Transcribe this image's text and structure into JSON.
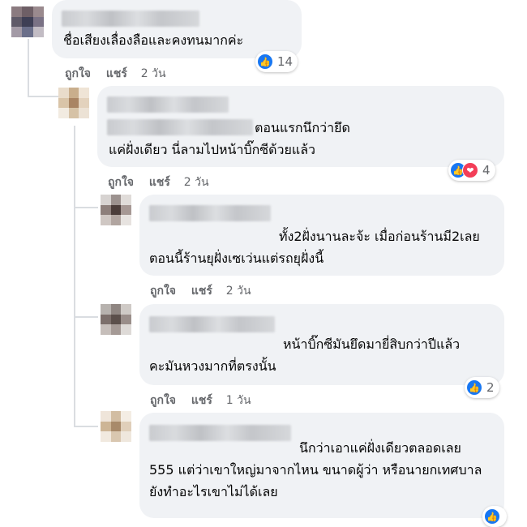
{
  "action_labels": {
    "like": "ถูกใจ",
    "share": "แชร์"
  },
  "comments": [
    {
      "text": "ชื่อเสียงเลื่องลือและคงทนมากค่ะ",
      "time": "2 วัน",
      "reaction_count": "14"
    },
    {
      "text": "ตอนแรกนึกว่ายึดแค่ฝั่งเดียว นี่ลามไปหน้าบิ๊กซีด้วยแล้ว",
      "time": "2 วัน",
      "reaction_count": "4"
    },
    {
      "text": "ทั้ง2ฝั่งนานละจ้ะ เมื่อก่อนร้านมี2เลย ตอนนี้ร้านยุฝั่งเซเว่นแต่รถยุฝั่งนี้",
      "time": "2 วัน"
    },
    {
      "text": "หน้าบิ๊กซีมันยึดมายี่สิบกว่าปีแล้วคะมันหวงมากที่ตรงนั้น",
      "time": "1 วัน",
      "reaction_count": "2"
    },
    {
      "text": "นึกว่าเอาแค่ฝั่งเดียวตลอดเลย 555 แต่ว่าเขาใหญ่มาจากไหน ขนาดผู้ว่า หรือนายกเทศบาล ยังทำอะไรเขาไม่ได้เลย"
    }
  ],
  "colors": {
    "bubble": "#f0f2f5",
    "like_blue": "#1877f2",
    "love_red": "#f33e58",
    "meta_gray": "#65676b"
  },
  "icons": {
    "like": "thumbs-up-icon",
    "love": "heart-icon"
  }
}
